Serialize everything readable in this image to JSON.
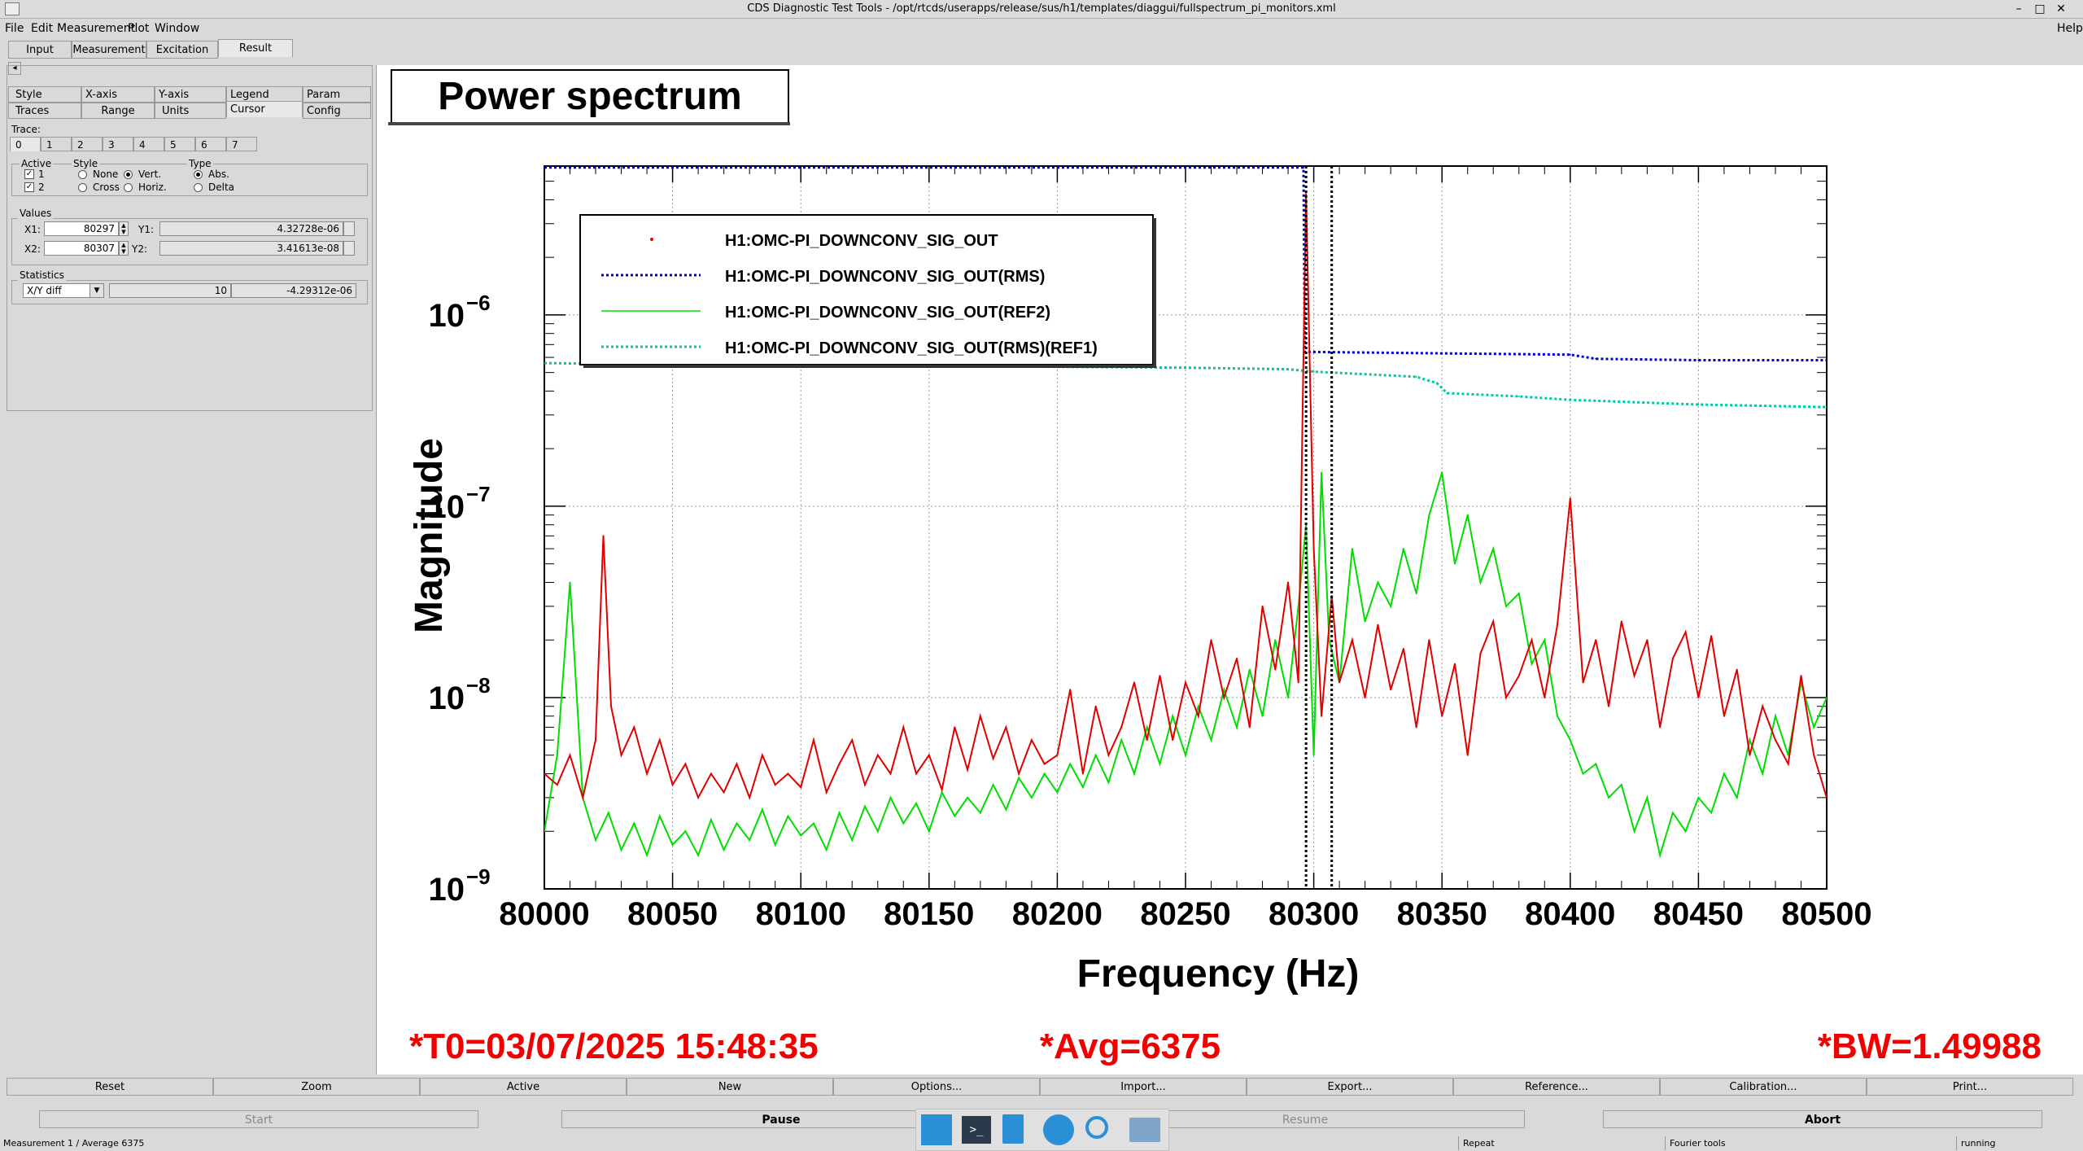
{
  "window": {
    "title": "CDS Diagnostic Test Tools - /opt/rtcds/userapps/release/sus/h1/templates/diaggui/fullspectrum_pi_monitors.xml"
  },
  "menu": {
    "file": "File",
    "edit": "Edit",
    "measurement": "Measurement",
    "plot": "Plot",
    "window": "Window",
    "help": "Help"
  },
  "main_tabs": [
    "Input",
    "Measurement",
    "Excitation",
    "Result"
  ],
  "option_tabs_row1": [
    "Style",
    "X-axis",
    "Y-axis",
    "Legend",
    "Param"
  ],
  "option_tabs_row2": [
    "Traces",
    "Range",
    "Units",
    "Cursor",
    "Config"
  ],
  "trace": {
    "label": "Trace:",
    "tabs": [
      "0",
      "1",
      "2",
      "3",
      "4",
      "5",
      "6",
      "7"
    ]
  },
  "active": {
    "label": "Active",
    "c1": "1",
    "c2": "2"
  },
  "style": {
    "label": "Style",
    "none": "None",
    "vert": "Vert.",
    "cross": "Cross",
    "horiz": "Horiz."
  },
  "type": {
    "label": "Type",
    "abs": "Abs.",
    "delta": "Delta"
  },
  "values": {
    "label": "Values",
    "x1_label": "X1:",
    "x1": "80297",
    "y1_label": "Y1:",
    "y1": "4.32728e-06",
    "x2_label": "X2:",
    "x2": "80307",
    "y2_label": "Y2:",
    "y2": "3.41613e-08"
  },
  "statistics": {
    "label": "Statistics",
    "mode": "X/Y diff",
    "n": "10",
    "diff": "-4.29312e-06"
  },
  "plot": {
    "title": "Power spectrum",
    "t0": "*T0=03/07/2025 15:48:35",
    "avg": "*Avg=6375",
    "bw": "*BW=1.49988"
  },
  "chart_data": {
    "type": "line",
    "title": "",
    "xlabel": "Frequency (Hz)",
    "ylabel": "Magnitude",
    "xlim": [
      80000,
      80500
    ],
    "ylim": [
      1e-09,
      6e-06
    ],
    "yscale": "log",
    "grid": true,
    "legend_position": "top-left",
    "x_ticks": [
      "80000",
      "80050",
      "80100",
      "80150",
      "80200",
      "80250",
      "80300",
      "80350",
      "80400",
      "80450",
      "80500"
    ],
    "y_ticks": [
      {
        "mant": "10",
        "exp": "−9",
        "v": 1e-09
      },
      {
        "mant": "10",
        "exp": "−8",
        "v": 1e-08
      },
      {
        "mant": "10",
        "exp": "−7",
        "v": 1e-07
      },
      {
        "mant": "10",
        "exp": "−6",
        "v": 1e-06
      }
    ],
    "cursors": [
      80297,
      80307
    ],
    "series": [
      {
        "name": "H1:OMC-PI_DOWNCONV_SIG_OUT",
        "color": "#e00000",
        "style": "solid",
        "x": [
          80000,
          80005,
          80010,
          80015,
          80020,
          80023,
          80026,
          80030,
          80035,
          80040,
          80045,
          80050,
          80055,
          80060,
          80065,
          80070,
          80075,
          80080,
          80085,
          80090,
          80095,
          80100,
          80105,
          80110,
          80115,
          80120,
          80125,
          80130,
          80135,
          80140,
          80145,
          80150,
          80155,
          80160,
          80165,
          80170,
          80175,
          80180,
          80185,
          80190,
          80195,
          80200,
          80205,
          80210,
          80215,
          80220,
          80225,
          80230,
          80235,
          80240,
          80245,
          80250,
          80255,
          80260,
          80265,
          80270,
          80275,
          80280,
          80285,
          80290,
          80294,
          80297,
          80300,
          80303,
          80307,
          80310,
          80315,
          80320,
          80325,
          80330,
          80335,
          80340,
          80345,
          80350,
          80355,
          80360,
          80365,
          80370,
          80375,
          80380,
          80385,
          80390,
          80395,
          80400,
          80405,
          80410,
          80415,
          80420,
          80425,
          80430,
          80435,
          80440,
          80445,
          80450,
          80455,
          80460,
          80465,
          80470,
          80475,
          80480,
          80485,
          80490,
          80495,
          80500
        ],
        "y": [
          4e-09,
          3.5e-09,
          5e-09,
          3e-09,
          6e-09,
          7e-08,
          9e-09,
          5e-09,
          7e-09,
          4e-09,
          6e-09,
          3.5e-09,
          4.5e-09,
          3e-09,
          4e-09,
          3.2e-09,
          4.5e-09,
          3e-09,
          5e-09,
          3.5e-09,
          4e-09,
          3.4e-09,
          6e-09,
          3.2e-09,
          4.5e-09,
          6e-09,
          3.5e-09,
          5e-09,
          4e-09,
          7e-09,
          4e-09,
          5e-09,
          3.3e-09,
          7e-09,
          4.2e-09,
          8e-09,
          4.8e-09,
          7e-09,
          4e-09,
          6e-09,
          4.5e-09,
          5e-09,
          1.1e-08,
          4e-09,
          9e-09,
          5e-09,
          7e-09,
          1.2e-08,
          6e-09,
          1.3e-08,
          6e-09,
          1.2e-08,
          8e-09,
          2e-08,
          1e-08,
          1.6e-08,
          7e-09,
          3e-08,
          1.4e-08,
          4e-08,
          1.2e-08,
          4.3e-06,
          6e-08,
          8e-09,
          3.4e-08,
          1.2e-08,
          2e-08,
          1e-08,
          2.4e-08,
          1.1e-08,
          1.8e-08,
          7e-09,
          2e-08,
          8e-09,
          1.5e-08,
          5e-09,
          1.7e-08,
          2.5e-08,
          1e-08,
          1.3e-08,
          2e-08,
          1e-08,
          2.4e-08,
          1.1e-07,
          1.2e-08,
          2e-08,
          9e-09,
          2.5e-08,
          1.3e-08,
          2e-08,
          7e-09,
          1.6e-08,
          2.2e-08,
          1e-08,
          2.1e-08,
          8e-09,
          1.4e-08,
          5e-09,
          9e-09,
          6e-09,
          4.5e-09,
          1.3e-08,
          5e-09,
          3e-09
        ]
      },
      {
        "name": "H1:OMC-PI_DOWNCONV_SIG_OUT(RMS)",
        "color": "#0000d0",
        "style": "dotted",
        "x": [
          80000,
          80296,
          80296.5,
          80300,
          80350,
          80400,
          80410,
          80450,
          80500
        ],
        "y": [
          5.9e-06,
          5.9e-06,
          6.4e-07,
          6.4e-07,
          6.3e-07,
          6.2e-07,
          5.9e-07,
          5.8e-07,
          5.8e-07
        ]
      },
      {
        "name": "H1:OMC-PI_DOWNCONV_SIG_OUT(REF2)",
        "color": "#00dd00",
        "style": "solid",
        "x": [
          80000,
          80005,
          80010,
          80015,
          80020,
          80025,
          80030,
          80035,
          80040,
          80045,
          80050,
          80055,
          80060,
          80065,
          80070,
          80075,
          80080,
          80085,
          80090,
          80095,
          80100,
          80105,
          80110,
          80115,
          80120,
          80125,
          80130,
          80135,
          80140,
          80145,
          80150,
          80155,
          80160,
          80165,
          80170,
          80175,
          80180,
          80185,
          80190,
          80195,
          80200,
          80205,
          80210,
          80215,
          80220,
          80225,
          80230,
          80235,
          80240,
          80245,
          80250,
          80255,
          80260,
          80265,
          80270,
          80275,
          80280,
          80285,
          80290,
          80294,
          80297,
          80300,
          80303,
          80306,
          80310,
          80315,
          80320,
          80325,
          80330,
          80335,
          80340,
          80345,
          80350,
          80355,
          80360,
          80365,
          80370,
          80375,
          80380,
          80385,
          80390,
          80395,
          80400,
          80405,
          80410,
          80415,
          80420,
          80425,
          80430,
          80435,
          80440,
          80445,
          80450,
          80455,
          80460,
          80465,
          80470,
          80475,
          80480,
          80485,
          80490,
          80495,
          80500
        ],
        "y": [
          2e-09,
          5e-09,
          4e-08,
          3e-09,
          1.8e-09,
          2.5e-09,
          1.6e-09,
          2.2e-09,
          1.5e-09,
          2.4e-09,
          1.7e-09,
          2e-09,
          1.5e-09,
          2.3e-09,
          1.6e-09,
          2.2e-09,
          1.8e-09,
          2.6e-09,
          1.7e-09,
          2.4e-09,
          1.9e-09,
          2.2e-09,
          1.6e-09,
          2.5e-09,
          1.8e-09,
          2.7e-09,
          2e-09,
          3e-09,
          2.2e-09,
          2.8e-09,
          2e-09,
          3.2e-09,
          2.4e-09,
          3e-09,
          2.5e-09,
          3.5e-09,
          2.6e-09,
          3.8e-09,
          3e-09,
          4e-09,
          3.2e-09,
          4.5e-09,
          3.4e-09,
          5e-09,
          3.6e-09,
          6e-09,
          4e-09,
          7e-09,
          4.5e-09,
          8e-09,
          5e-09,
          9e-09,
          6e-09,
          1.1e-08,
          7e-09,
          1.4e-08,
          8e-09,
          2e-08,
          1e-08,
          3e-08,
          8e-08,
          5e-09,
          1.5e-07,
          2e-08,
          1.2e-08,
          6e-08,
          2.5e-08,
          4e-08,
          3e-08,
          6e-08,
          3.5e-08,
          9e-08,
          1.5e-07,
          5e-08,
          9e-08,
          4e-08,
          6e-08,
          3e-08,
          3.5e-08,
          1.5e-08,
          2e-08,
          8e-09,
          6e-09,
          4e-09,
          4.5e-09,
          3e-09,
          3.5e-09,
          2e-09,
          3e-09,
          1.5e-09,
          2.5e-09,
          2e-09,
          3e-09,
          2.5e-09,
          4e-09,
          3e-09,
          6e-09,
          4e-09,
          8e-09,
          5e-09,
          1.2e-08,
          7e-09,
          1e-08
        ]
      },
      {
        "name": "H1:OMC-PI_DOWNCONV_SIG_OUT(RMS)(REF1)",
        "color": "#00c8a0",
        "style": "dotted",
        "x": [
          80000,
          80050,
          80100,
          80150,
          80200,
          80250,
          80290,
          80300,
          80320,
          80340,
          80348,
          80352,
          80380,
          80400,
          80450,
          80500
        ],
        "y": [
          5.6e-07,
          5.5e-07,
          5.45e-07,
          5.4e-07,
          5.35e-07,
          5.3e-07,
          5.2e-07,
          5.05e-07,
          4.9e-07,
          4.75e-07,
          4.4e-07,
          3.9e-07,
          3.75e-07,
          3.6e-07,
          3.4e-07,
          3.3e-07
        ]
      }
    ]
  },
  "bottom_buttons_row1": [
    "Reset",
    "Zoom",
    "Active",
    "New",
    "Import...",
    "Export...",
    "Reference...",
    "Calibration...",
    "Print..."
  ],
  "bottom_buttons_row1b": [
    "Options..."
  ],
  "bottom_buttons_row2": [
    "Start",
    "Pause",
    "Resume",
    "Abort"
  ],
  "status": {
    "left": "Measurement 1 / Average 6375",
    "repeat": "Repeat",
    "tools": "Fourier tools",
    "state": "running"
  }
}
